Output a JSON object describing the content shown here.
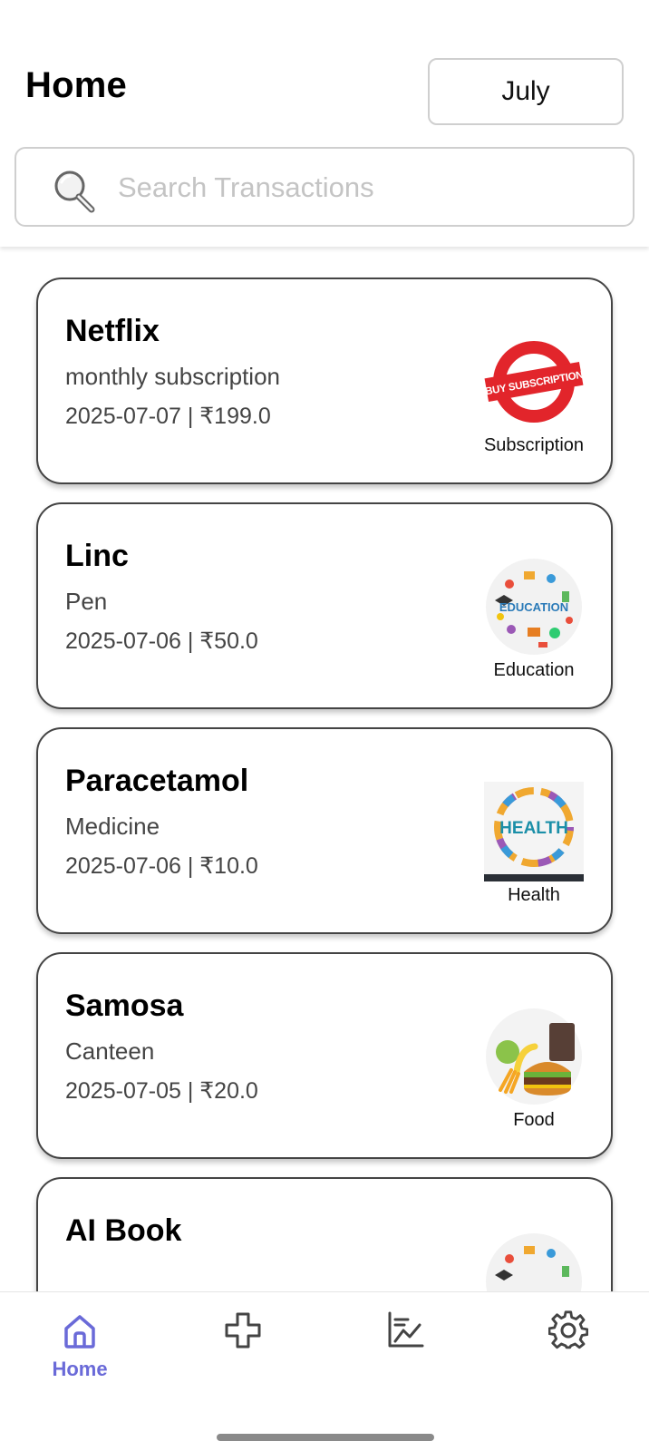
{
  "header": {
    "title": "Home",
    "month": "July",
    "search_placeholder": "Search Transactions",
    "search_value": ""
  },
  "transactions": [
    {
      "title": "Netflix",
      "description": "monthly subscription",
      "date": "2025-07-07",
      "amount": "₹199.0",
      "meta": "2025-07-07 | ₹199.0",
      "category": "Subscription",
      "category_icon": "buy-subscription-stamp-icon"
    },
    {
      "title": "Linc",
      "description": "Pen",
      "date": "2025-07-06",
      "amount": "₹50.0",
      "meta": "2025-07-06 | ₹50.0",
      "category": "Education",
      "category_icon": "education-doodle-icon"
    },
    {
      "title": "Paracetamol",
      "description": "Medicine",
      "date": "2025-07-06",
      "amount": "₹10.0",
      "meta": "2025-07-06 | ₹10.0",
      "category": "Health",
      "category_icon": "health-word-cloud-icon"
    },
    {
      "title": "Samosa",
      "description": "Canteen",
      "date": "2025-07-05",
      "amount": "₹20.0",
      "meta": "2025-07-05 | ₹20.0",
      "category": "Food",
      "category_icon": "food-burger-icon"
    },
    {
      "title": "AI Book",
      "category_icon": "education-doodle-icon"
    }
  ],
  "nav": {
    "home_label": "Home",
    "active": "home",
    "active_color": "#6a6ad8",
    "icons": [
      "home-icon",
      "add-icon",
      "chart-icon",
      "settings-icon"
    ]
  },
  "colors": {
    "accent": "#6a6ad8",
    "stamp_red": "#e2252b",
    "card_border": "#444444"
  }
}
